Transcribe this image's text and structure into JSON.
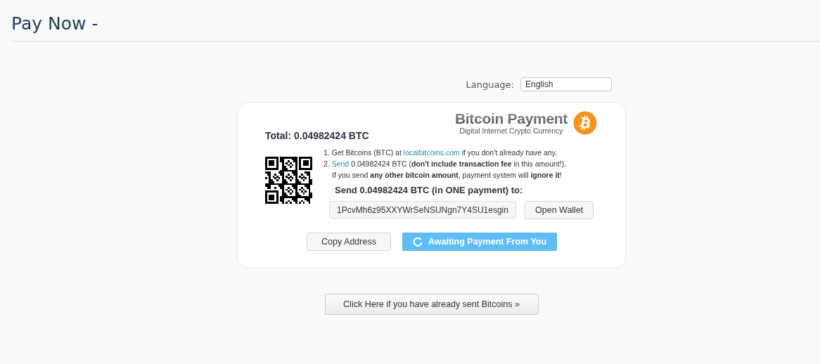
{
  "page_title": "Pay Now -",
  "language": {
    "label": "Language:",
    "value": "English"
  },
  "card": {
    "total": "Total: 0.04982424 BTC",
    "logo": {
      "title": "Bitcoin Payment",
      "subtitle": "Digital Internet Crypto Currency"
    },
    "steps": [
      {
        "number": "1.",
        "before": "Get Bitcoins (BTC) at ",
        "link": "localbitcoins.com",
        "after": " if you don't already have any."
      },
      {
        "number": "2.",
        "link": "Send",
        "after": " 0.04982424 BTC (**don't include transaction fee** in this amount!)."
      }
    ],
    "warning": "If you send **any other bitcoin amount**, payment system will **ignore it**!",
    "send_line": "Send **0.04982424** BTC (in ONE payment) to:",
    "address": "1PcvMh6z95XXYWrSeNSUNgn7Y4SU1esgin",
    "open_wallet": "Open Wallet",
    "copy_address": "Copy Address",
    "status": "Awaiting Payment From You"
  },
  "sent_button": "Click Here if you have already sent Bitcoins »"
}
